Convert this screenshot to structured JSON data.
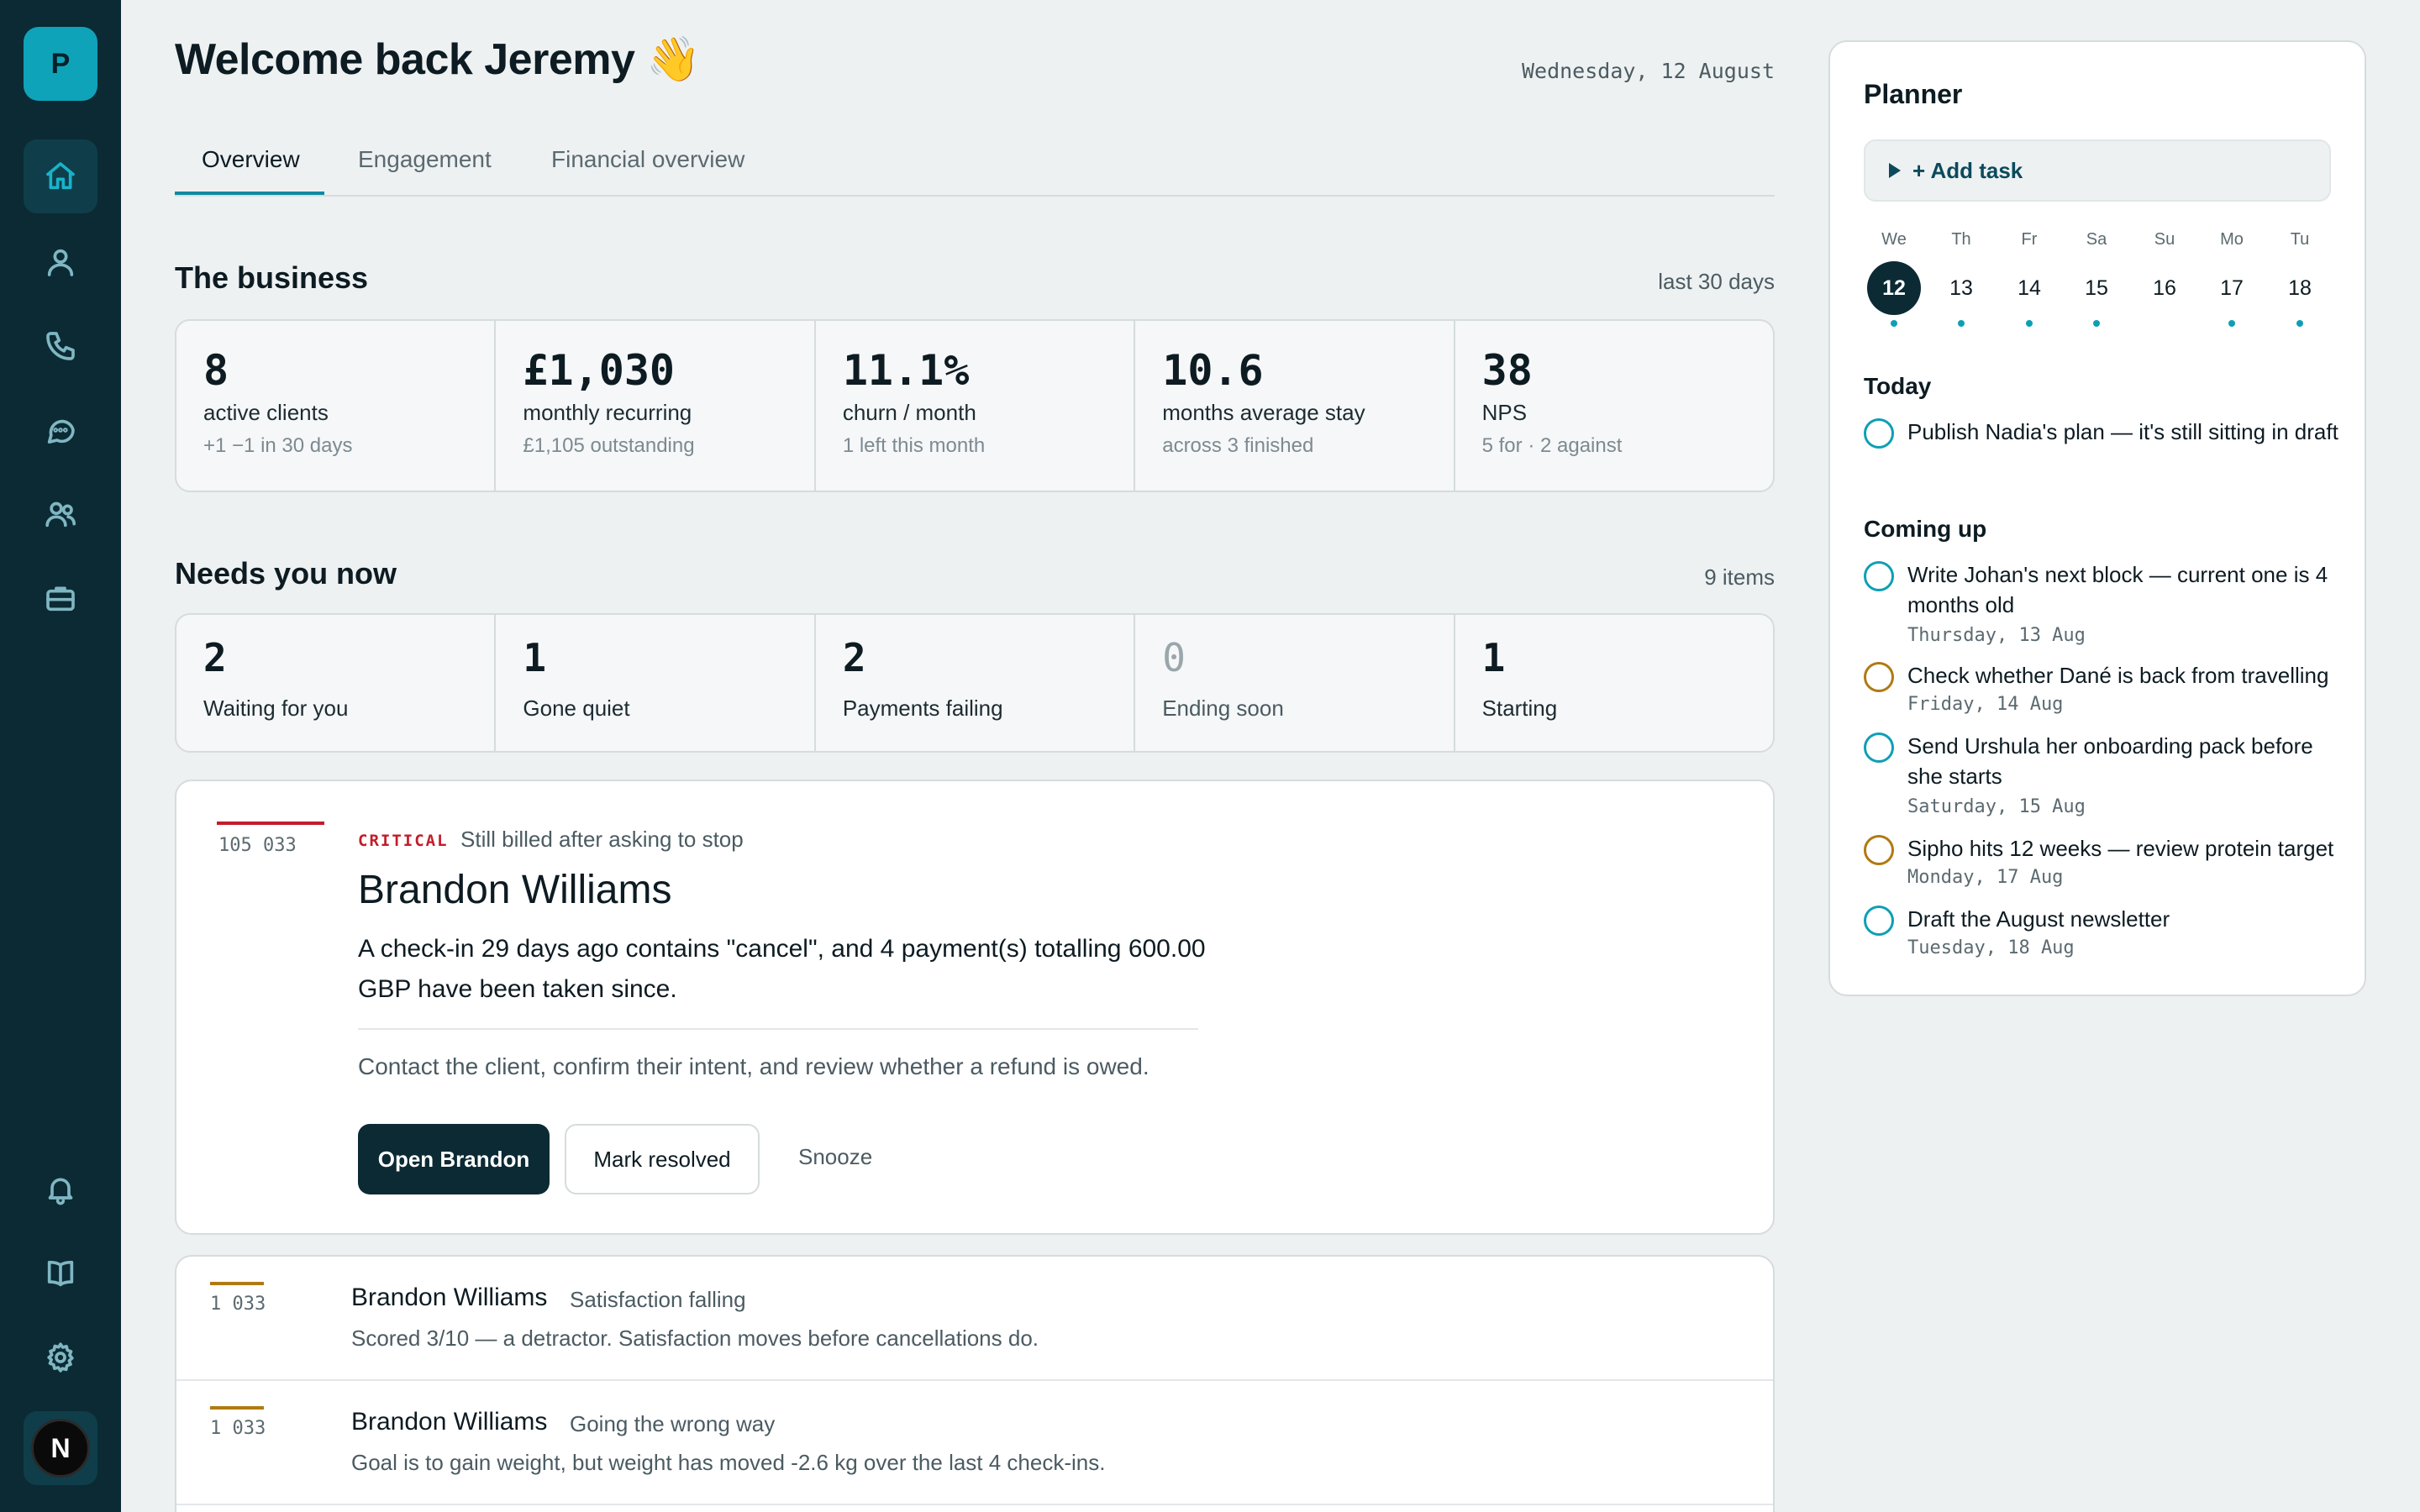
{
  "sidebar": {
    "logo_letter": "P",
    "nav": [
      {
        "name": "home",
        "icon": "home-icon",
        "active": true
      },
      {
        "name": "clients",
        "icon": "user-icon"
      },
      {
        "name": "calls",
        "icon": "phone-icon"
      },
      {
        "name": "messages",
        "icon": "chat-icon"
      },
      {
        "name": "groups",
        "icon": "users-icon"
      },
      {
        "name": "business",
        "icon": "briefcase-icon"
      },
      {
        "name": "notifications",
        "icon": "bell-icon"
      },
      {
        "name": "library",
        "icon": "book-icon"
      },
      {
        "name": "settings",
        "icon": "gear-icon"
      }
    ],
    "avatar_letter": "N"
  },
  "header": {
    "greeting": "Welcome back Jeremy 👋",
    "date": "Wednesday, 12 August"
  },
  "tabs": [
    "Overview",
    "Engagement",
    "Financial overview"
  ],
  "business": {
    "title": "The business",
    "meta": "last 30 days",
    "stats": [
      {
        "value": "8",
        "label": "active clients",
        "sub": "+1 −1 in 30 days"
      },
      {
        "value": "£1,030",
        "label": "monthly recurring",
        "sub": "£1,105 outstanding"
      },
      {
        "value": "11.1%",
        "label": "churn / month",
        "sub": "1 left this month"
      },
      {
        "value": "10.6",
        "label": "months average stay",
        "sub": "across 3 finished"
      },
      {
        "value": "38",
        "label": "NPS",
        "sub": "5 for · 2 against"
      }
    ]
  },
  "needs": {
    "title": "Needs you now",
    "meta": "9 items",
    "stats": [
      {
        "value": "2",
        "label": "Waiting for you"
      },
      {
        "value": "1",
        "label": "Gone quiet"
      },
      {
        "value": "2",
        "label": "Payments failing"
      },
      {
        "value": "0",
        "label": "Ending soon"
      },
      {
        "value": "1",
        "label": "Starting"
      }
    ]
  },
  "critical": {
    "id": "105 033",
    "tag": "CRITICAL",
    "reason": "Still billed after asking to stop",
    "name": "Brandon Williams",
    "description": "A check-in 29 days ago contains \"cancel\", and 4 payment(s) totalling 600.00 GBP have been taken since.",
    "action": "Contact the client, confirm their intent, and review whether a refund is owed.",
    "buttons": {
      "open": "Open Brandon",
      "resolve": "Mark resolved",
      "snooze": "Snooze"
    }
  },
  "list": [
    {
      "id": "1 033",
      "name": "Brandon Williams",
      "reason": "Satisfaction falling",
      "desc": "Scored 3/10 — a detractor. Satisfaction moves before cancellations do."
    },
    {
      "id": "1 033",
      "name": "Brandon Williams",
      "reason": "Going the wrong way",
      "desc": "Goal is to gain weight, but weight has moved -2.6 kg over the last 4 check-ins."
    }
  ],
  "planner": {
    "title": "Planner",
    "add_task": "+ Add task",
    "days": [
      {
        "name": "We",
        "num": "12",
        "selected": true,
        "dot": true
      },
      {
        "name": "Th",
        "num": "13",
        "dot": true
      },
      {
        "name": "Fr",
        "num": "14",
        "dot": true
      },
      {
        "name": "Sa",
        "num": "15",
        "dot": true
      },
      {
        "name": "Su",
        "num": "16",
        "dot": false
      },
      {
        "name": "Mo",
        "num": "17",
        "dot": true
      },
      {
        "name": "Tu",
        "num": "18",
        "dot": true
      }
    ],
    "today_heading": "Today",
    "today": [
      {
        "text": "Publish Nadia's plan — it's still sitting in draft",
        "color": "#0e9fb5"
      }
    ],
    "coming_heading": "Coming up",
    "coming": [
      {
        "text": "Write Johan's next block — current one is 4 months old",
        "date": "Thursday, 13 Aug",
        "color": "#0e9fb5"
      },
      {
        "text": "Check whether Dané is back from travelling",
        "date": "Friday, 14 Aug",
        "color": "#b07a12"
      },
      {
        "text": "Send Urshula her onboarding pack before she starts",
        "date": "Saturday, 15 Aug",
        "color": "#0e9fb5"
      },
      {
        "text": "Sipho hits 12 weeks — review protein target",
        "date": "Monday, 17 Aug",
        "color": "#b07a12"
      },
      {
        "text": "Draft the August newsletter",
        "date": "Tuesday, 18 Aug",
        "color": "#0e9fb5"
      }
    ]
  }
}
